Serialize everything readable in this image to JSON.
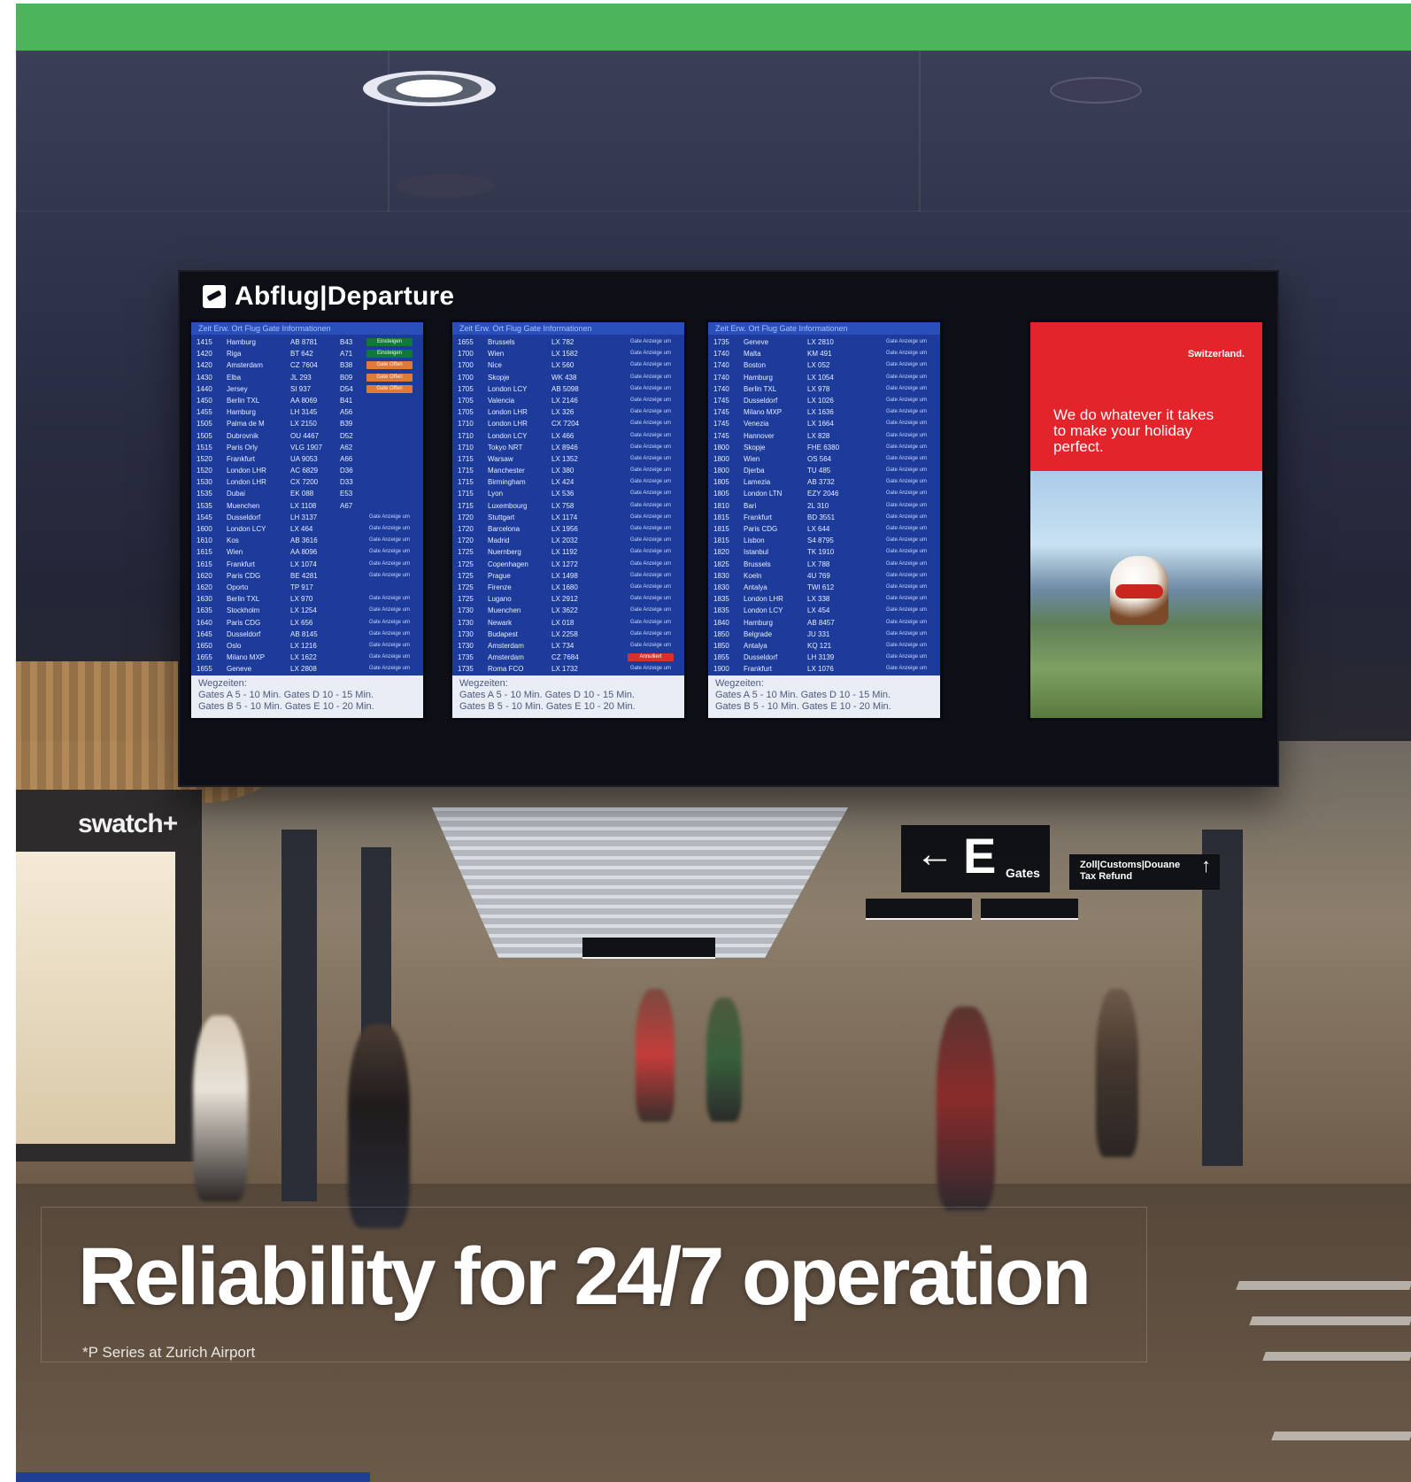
{
  "colors": {
    "top_band": "#4cb45a",
    "screen_blue": "#1c3b9a",
    "ad_red": "#e3242b",
    "bottom_bar": "#1f3f94"
  },
  "board": {
    "title": "Abflug|Departure"
  },
  "screens": [
    {
      "header": "Zeit  Erw. Ort          Flug          Gate   Informationen",
      "footer_line1": "Wegzeiten:",
      "footer_line2": "Gates A   5 - 10 Min.    Gates D   10 - 15 Min.",
      "footer_line3": "Gates B   5 - 10 Min.    Gates E   10 - 20 Min.",
      "rows": [
        [
          "1415",
          "Hamburg",
          "AB 8781",
          "B43",
          "Einsteigen",
          "boarding"
        ],
        [
          "1420",
          "Riga",
          "BT 642",
          "A71",
          "Einsteigen",
          "boarding"
        ],
        [
          "1420",
          "Amsterdam",
          "CZ 7604",
          "B38",
          "Gate Offen",
          "gate"
        ],
        [
          "1430",
          "Elba",
          "JL 293",
          "B09",
          "Gate Offen",
          "gate"
        ],
        [
          "1440",
          "Jersey",
          "SI 937",
          "D54",
          "Gate Offen",
          "gate"
        ],
        [
          "1450",
          "Berlin TXL",
          "AA 8069",
          "B41",
          "",
          ""
        ],
        [
          "1455",
          "Hamburg",
          "LH 3145",
          "A56",
          "",
          ""
        ],
        [
          "1505",
          "Palma de M",
          "LX 2150",
          "B39",
          "",
          ""
        ],
        [
          "1505",
          "Dubrovnik",
          "OU 4467",
          "D52",
          "",
          ""
        ],
        [
          "1515",
          "Paris Orly",
          "VLG 1907",
          "A62",
          "",
          ""
        ],
        [
          "1520",
          "Frankfurt",
          "UA 9053",
          "A66",
          "",
          ""
        ],
        [
          "1520",
          "London LHR",
          "AC 6829",
          "D36",
          "",
          ""
        ],
        [
          "1530",
          "London LHR",
          "CX 7200",
          "D33",
          "",
          ""
        ],
        [
          "1535",
          "Dubai",
          "EK 088",
          "E53",
          "",
          ""
        ],
        [
          "1535",
          "Muenchen",
          "LX 1108",
          "A67",
          "",
          ""
        ],
        [
          "1545",
          "Dusseldorf",
          "LH 3137",
          "",
          "Gate Anzeige um",
          "plain"
        ],
        [
          "1600",
          "London LCY",
          "LX 464",
          "",
          "Gate Anzeige um",
          "plain"
        ],
        [
          "1610",
          "Kos",
          "AB 3616",
          "",
          "Gate Anzeige um",
          "plain"
        ],
        [
          "1615",
          "Wien",
          "AA 8096",
          "",
          "Gate Anzeige um",
          "plain"
        ],
        [
          "1615",
          "Frankfurt",
          "LX 1074",
          "",
          "Gate Anzeige um",
          "plain"
        ],
        [
          "1620",
          "Paris CDG",
          "BE 4281",
          "",
          "Gate Anzeige um",
          "plain"
        ],
        [
          "1620",
          "Oporto",
          "TP 917",
          "",
          "",
          ""
        ],
        [
          "1630",
          "Berlin TXL",
          "LX 970",
          "",
          "Gate Anzeige um",
          "plain"
        ],
        [
          "1635",
          "Stockholm",
          "LX 1254",
          "",
          "Gate Anzeige um",
          "plain"
        ],
        [
          "1640",
          "Paris CDG",
          "LX 656",
          "",
          "Gate Anzeige um",
          "plain"
        ],
        [
          "1645",
          "Dusseldorf",
          "AB 8145",
          "",
          "Gate Anzeige um",
          "plain"
        ],
        [
          "1650",
          "Oslo",
          "LX 1216",
          "",
          "Gate Anzeige um",
          "plain"
        ],
        [
          "1655",
          "Milano MXP",
          "LX 1622",
          "",
          "Gate Anzeige um",
          "plain"
        ],
        [
          "1655",
          "Geneve",
          "LX 2808",
          "",
          "Gate Anzeige um",
          "plain"
        ]
      ]
    },
    {
      "header": "Zeit  Erw. Ort          Flug          Gate   Informationen",
      "footer_line1": "Wegzeiten:",
      "footer_line2": "Gates A   5 - 10 Min.    Gates D   10 - 15 Min.",
      "footer_line3": "Gates B   5 - 10 Min.    Gates E   10 - 20 Min.",
      "rows": [
        [
          "1655",
          "Brussels",
          "LX 782",
          "",
          "Gate Anzeige um",
          "plain"
        ],
        [
          "1700",
          "Wien",
          "LX 1582",
          "",
          "Gate Anzeige um",
          "plain"
        ],
        [
          "1700",
          "Nice",
          "LX 560",
          "",
          "Gate Anzeige um",
          "plain"
        ],
        [
          "1700",
          "Skopje",
          "WK 438",
          "",
          "Gate Anzeige um",
          "plain"
        ],
        [
          "1705",
          "London LCY",
          "AB 5098",
          "",
          "Gate Anzeige um",
          "plain"
        ],
        [
          "1705",
          "Valencia",
          "LX 2146",
          "",
          "Gate Anzeige um",
          "plain"
        ],
        [
          "1705",
          "London LHR",
          "LX 326",
          "",
          "Gate Anzeige um",
          "plain"
        ],
        [
          "1710",
          "London LHR",
          "CX 7204",
          "",
          "Gate Anzeige um",
          "plain"
        ],
        [
          "1710",
          "London LCY",
          "LX 466",
          "",
          "Gate Anzeige um",
          "plain"
        ],
        [
          "1710",
          "Tokyo NRT",
          "LX 8946",
          "",
          "Gate Anzeige um",
          "plain"
        ],
        [
          "1715",
          "Warsaw",
          "LX 1352",
          "",
          "Gate Anzeige um",
          "plain"
        ],
        [
          "1715",
          "Manchester",
          "LX 380",
          "",
          "Gate Anzeige um",
          "plain"
        ],
        [
          "1715",
          "Birmingham",
          "LX 424",
          "",
          "Gate Anzeige um",
          "plain"
        ],
        [
          "1715",
          "Lyon",
          "LX 536",
          "",
          "Gate Anzeige um",
          "plain"
        ],
        [
          "1715",
          "Luxembourg",
          "LX 758",
          "",
          "Gate Anzeige um",
          "plain"
        ],
        [
          "1720",
          "Stuttgart",
          "LX 1174",
          "",
          "Gate Anzeige um",
          "plain"
        ],
        [
          "1720",
          "Barcelona",
          "LX 1956",
          "",
          "Gate Anzeige um",
          "plain"
        ],
        [
          "1720",
          "Madrid",
          "LX 2032",
          "",
          "Gate Anzeige um",
          "plain"
        ],
        [
          "1725",
          "Nuernberg",
          "LX 1192",
          "",
          "Gate Anzeige um",
          "plain"
        ],
        [
          "1725",
          "Copenhagen",
          "LX 1272",
          "",
          "Gate Anzeige um",
          "plain"
        ],
        [
          "1725",
          "Prague",
          "LX 1498",
          "",
          "Gate Anzeige um",
          "plain"
        ],
        [
          "1725",
          "Firenze",
          "LX 1680",
          "",
          "Gate Anzeige um",
          "plain"
        ],
        [
          "1725",
          "Lugano",
          "LX 2912",
          "",
          "Gate Anzeige um",
          "plain"
        ],
        [
          "1730",
          "Muenchen",
          "LX 3622",
          "",
          "Gate Anzeige um",
          "plain"
        ],
        [
          "1730",
          "Newark",
          "LX 018",
          "",
          "Gate Anzeige um",
          "plain"
        ],
        [
          "1730",
          "Budapest",
          "LX 2258",
          "",
          "Gate Anzeige um",
          "plain"
        ],
        [
          "1730",
          "Amsterdam",
          "LX 734",
          "",
          "Gate Anzeige um",
          "plain"
        ],
        [
          "1735",
          "Amsterdam",
          "CZ 7684",
          "",
          "Annulliert",
          "cancel"
        ],
        [
          "1735",
          "Roma FCO",
          "LX 1732",
          "",
          "Gate Anzeige um",
          "plain"
        ]
      ]
    },
    {
      "header": "Zeit  Erw. Ort          Flug          Gate   Informationen",
      "footer_line1": "Wegzeiten:",
      "footer_line2": "Gates A   5 - 10 Min.    Gates D   10 - 15 Min.",
      "footer_line3": "Gates B   5 - 10 Min.    Gates E   10 - 20 Min.",
      "rows": [
        [
          "1735",
          "Geneve",
          "LX 2810",
          "",
          "Gate Anzeige um",
          "plain"
        ],
        [
          "1740",
          "Malta",
          "KM 491",
          "",
          "Gate Anzeige um",
          "plain"
        ],
        [
          "1740",
          "Boston",
          "LX 052",
          "",
          "Gate Anzeige um",
          "plain"
        ],
        [
          "1740",
          "Hamburg",
          "LX 1054",
          "",
          "Gate Anzeige um",
          "plain"
        ],
        [
          "1740",
          "Berlin TXL",
          "LX 978",
          "",
          "Gate Anzeige um",
          "plain"
        ],
        [
          "1745",
          "Dusseldorf",
          "LX 1026",
          "",
          "Gate Anzeige um",
          "plain"
        ],
        [
          "1745",
          "Milano MXP",
          "LX 1636",
          "",
          "Gate Anzeige um",
          "plain"
        ],
        [
          "1745",
          "Venezia",
          "LX 1664",
          "",
          "Gate Anzeige um",
          "plain"
        ],
        [
          "1745",
          "Hannover",
          "LX 828",
          "",
          "Gate Anzeige um",
          "plain"
        ],
        [
          "1800",
          "Skopje",
          "FHE 6380",
          "",
          "Gate Anzeige um",
          "plain"
        ],
        [
          "1800",
          "Wien",
          "OS 564",
          "",
          "Gate Anzeige um",
          "plain"
        ],
        [
          "1800",
          "Djerba",
          "TU 485",
          "",
          "Gate Anzeige um",
          "plain"
        ],
        [
          "1805",
          "Lamezia",
          "AB 3732",
          "",
          "Gate Anzeige um",
          "plain"
        ],
        [
          "1805",
          "London LTN",
          "EZY 2046",
          "",
          "Gate Anzeige um",
          "plain"
        ],
        [
          "1810",
          "Bari",
          "2L 310",
          "",
          "Gate Anzeige um",
          "plain"
        ],
        [
          "1815",
          "Frankfurt",
          "BD 3551",
          "",
          "Gate Anzeige um",
          "plain"
        ],
        [
          "1815",
          "Paris CDG",
          "LX 644",
          "",
          "Gate Anzeige um",
          "plain"
        ],
        [
          "1815",
          "Lisbon",
          "S4 8795",
          "",
          "Gate Anzeige um",
          "plain"
        ],
        [
          "1820",
          "Istanbul",
          "TK 1910",
          "",
          "Gate Anzeige um",
          "plain"
        ],
        [
          "1825",
          "Brussels",
          "LX 788",
          "",
          "Gate Anzeige um",
          "plain"
        ],
        [
          "1830",
          "Koeln",
          "4U 769",
          "",
          "Gate Anzeige um",
          "plain"
        ],
        [
          "1830",
          "Antalya",
          "TWI 612",
          "",
          "Gate Anzeige um",
          "plain"
        ],
        [
          "1835",
          "London LHR",
          "LX 338",
          "",
          "Gate Anzeige um",
          "plain"
        ],
        [
          "1835",
          "London LCY",
          "LX 454",
          "",
          "Gate Anzeige um",
          "plain"
        ],
        [
          "1840",
          "Hamburg",
          "AB 8457",
          "",
          "Gate Anzeige um",
          "plain"
        ],
        [
          "1850",
          "Belgrade",
          "JU 331",
          "",
          "Gate Anzeige um",
          "plain"
        ],
        [
          "1850",
          "Antalya",
          "KQ 121",
          "",
          "Gate Anzeige um",
          "plain"
        ],
        [
          "1855",
          "Dusseldorf",
          "LH 3139",
          "",
          "Gate Anzeige um",
          "plain"
        ],
        [
          "1900",
          "Frankfurt",
          "LX 1076",
          "",
          "Gate Anzeige um",
          "plain"
        ]
      ]
    }
  ],
  "ad": {
    "brand": "Switzerland.",
    "text": "We do whatever it takes to make your holiday perfect."
  },
  "store_sign": "swatch+",
  "gate_sign": {
    "arrow": "←",
    "letter": "E",
    "word": "Gates"
  },
  "customs_sign": {
    "line1": "Zoll|Customs|Douane",
    "line2": "Tax Refund",
    "arrow": "↑"
  },
  "headline": "Reliability for 24/7 operation",
  "caption": "*P Series at Zurich Airport"
}
